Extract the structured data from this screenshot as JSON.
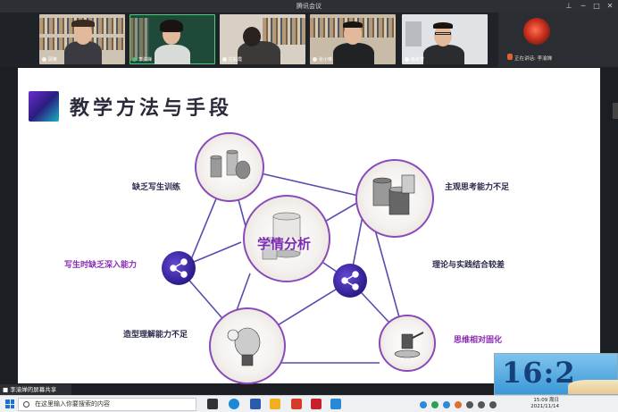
{
  "window": {
    "title": "腾讯会议"
  },
  "participants": [
    {
      "name": "顾某"
    },
    {
      "name": "李渝婵"
    },
    {
      "name": "庄彩霞"
    },
    {
      "name": "张小琳"
    },
    {
      "name": "韩俊雪"
    }
  ],
  "speaking": {
    "label": "正在讲话: 李渝婵"
  },
  "slide": {
    "title": "教学方法与手段",
    "center": "学情分析",
    "nodes": {
      "top_left": "缺乏写生训练",
      "top_right": "主观思考能力不足",
      "left": "写生时缺乏深入能力",
      "right": "理论与实践结合较差",
      "bottom_left": "造型理解能力不足",
      "bottom_right": "思维相对固化"
    }
  },
  "share_banner": {
    "text": "李渝婵的屏幕共享"
  },
  "taskbar": {
    "search_placeholder": "在这里输入你要搜索的内容",
    "time": "15:09 周日",
    "date": "2021/11/14"
  },
  "overlay_clock": {
    "text": "16:2"
  },
  "colors": {
    "accent": "#8a4ab8",
    "share_node": "#2a1c8a"
  }
}
